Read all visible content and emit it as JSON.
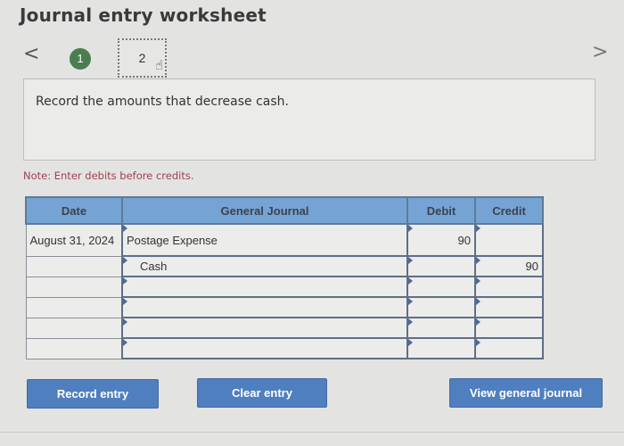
{
  "header": {
    "title": "Journal entry worksheet"
  },
  "navigation": {
    "prev_icon": "<",
    "next_icon": ">",
    "steps": [
      {
        "label": "1",
        "status": "completed"
      },
      {
        "label": "2",
        "status": "current"
      }
    ],
    "cursor_icon": "hand-pointer-icon"
  },
  "instruction": {
    "text": "Record the amounts that decrease cash."
  },
  "note": {
    "text": "Note: Enter debits before credits."
  },
  "journal": {
    "headers": {
      "date": "Date",
      "account": "General Journal",
      "debit": "Debit",
      "credit": "Credit"
    },
    "rows": [
      {
        "date": "August 31, 2024",
        "account": "Postage Expense",
        "debit": "90",
        "credit": ""
      },
      {
        "date": "",
        "account": "Cash",
        "debit": "",
        "credit": "90"
      },
      {
        "date": "",
        "account": "",
        "debit": "",
        "credit": ""
      },
      {
        "date": "",
        "account": "",
        "debit": "",
        "credit": ""
      },
      {
        "date": "",
        "account": "",
        "debit": "",
        "credit": ""
      },
      {
        "date": "",
        "account": "",
        "debit": "",
        "credit": ""
      }
    ]
  },
  "buttons": {
    "record": "Record entry",
    "clear": "Clear entry",
    "view": "View general journal"
  },
  "colors": {
    "header_bg": "#75a4d4",
    "button_bg": "#4f7fbe",
    "step_completed": "#4b7d50",
    "note_text": "#a04050"
  }
}
